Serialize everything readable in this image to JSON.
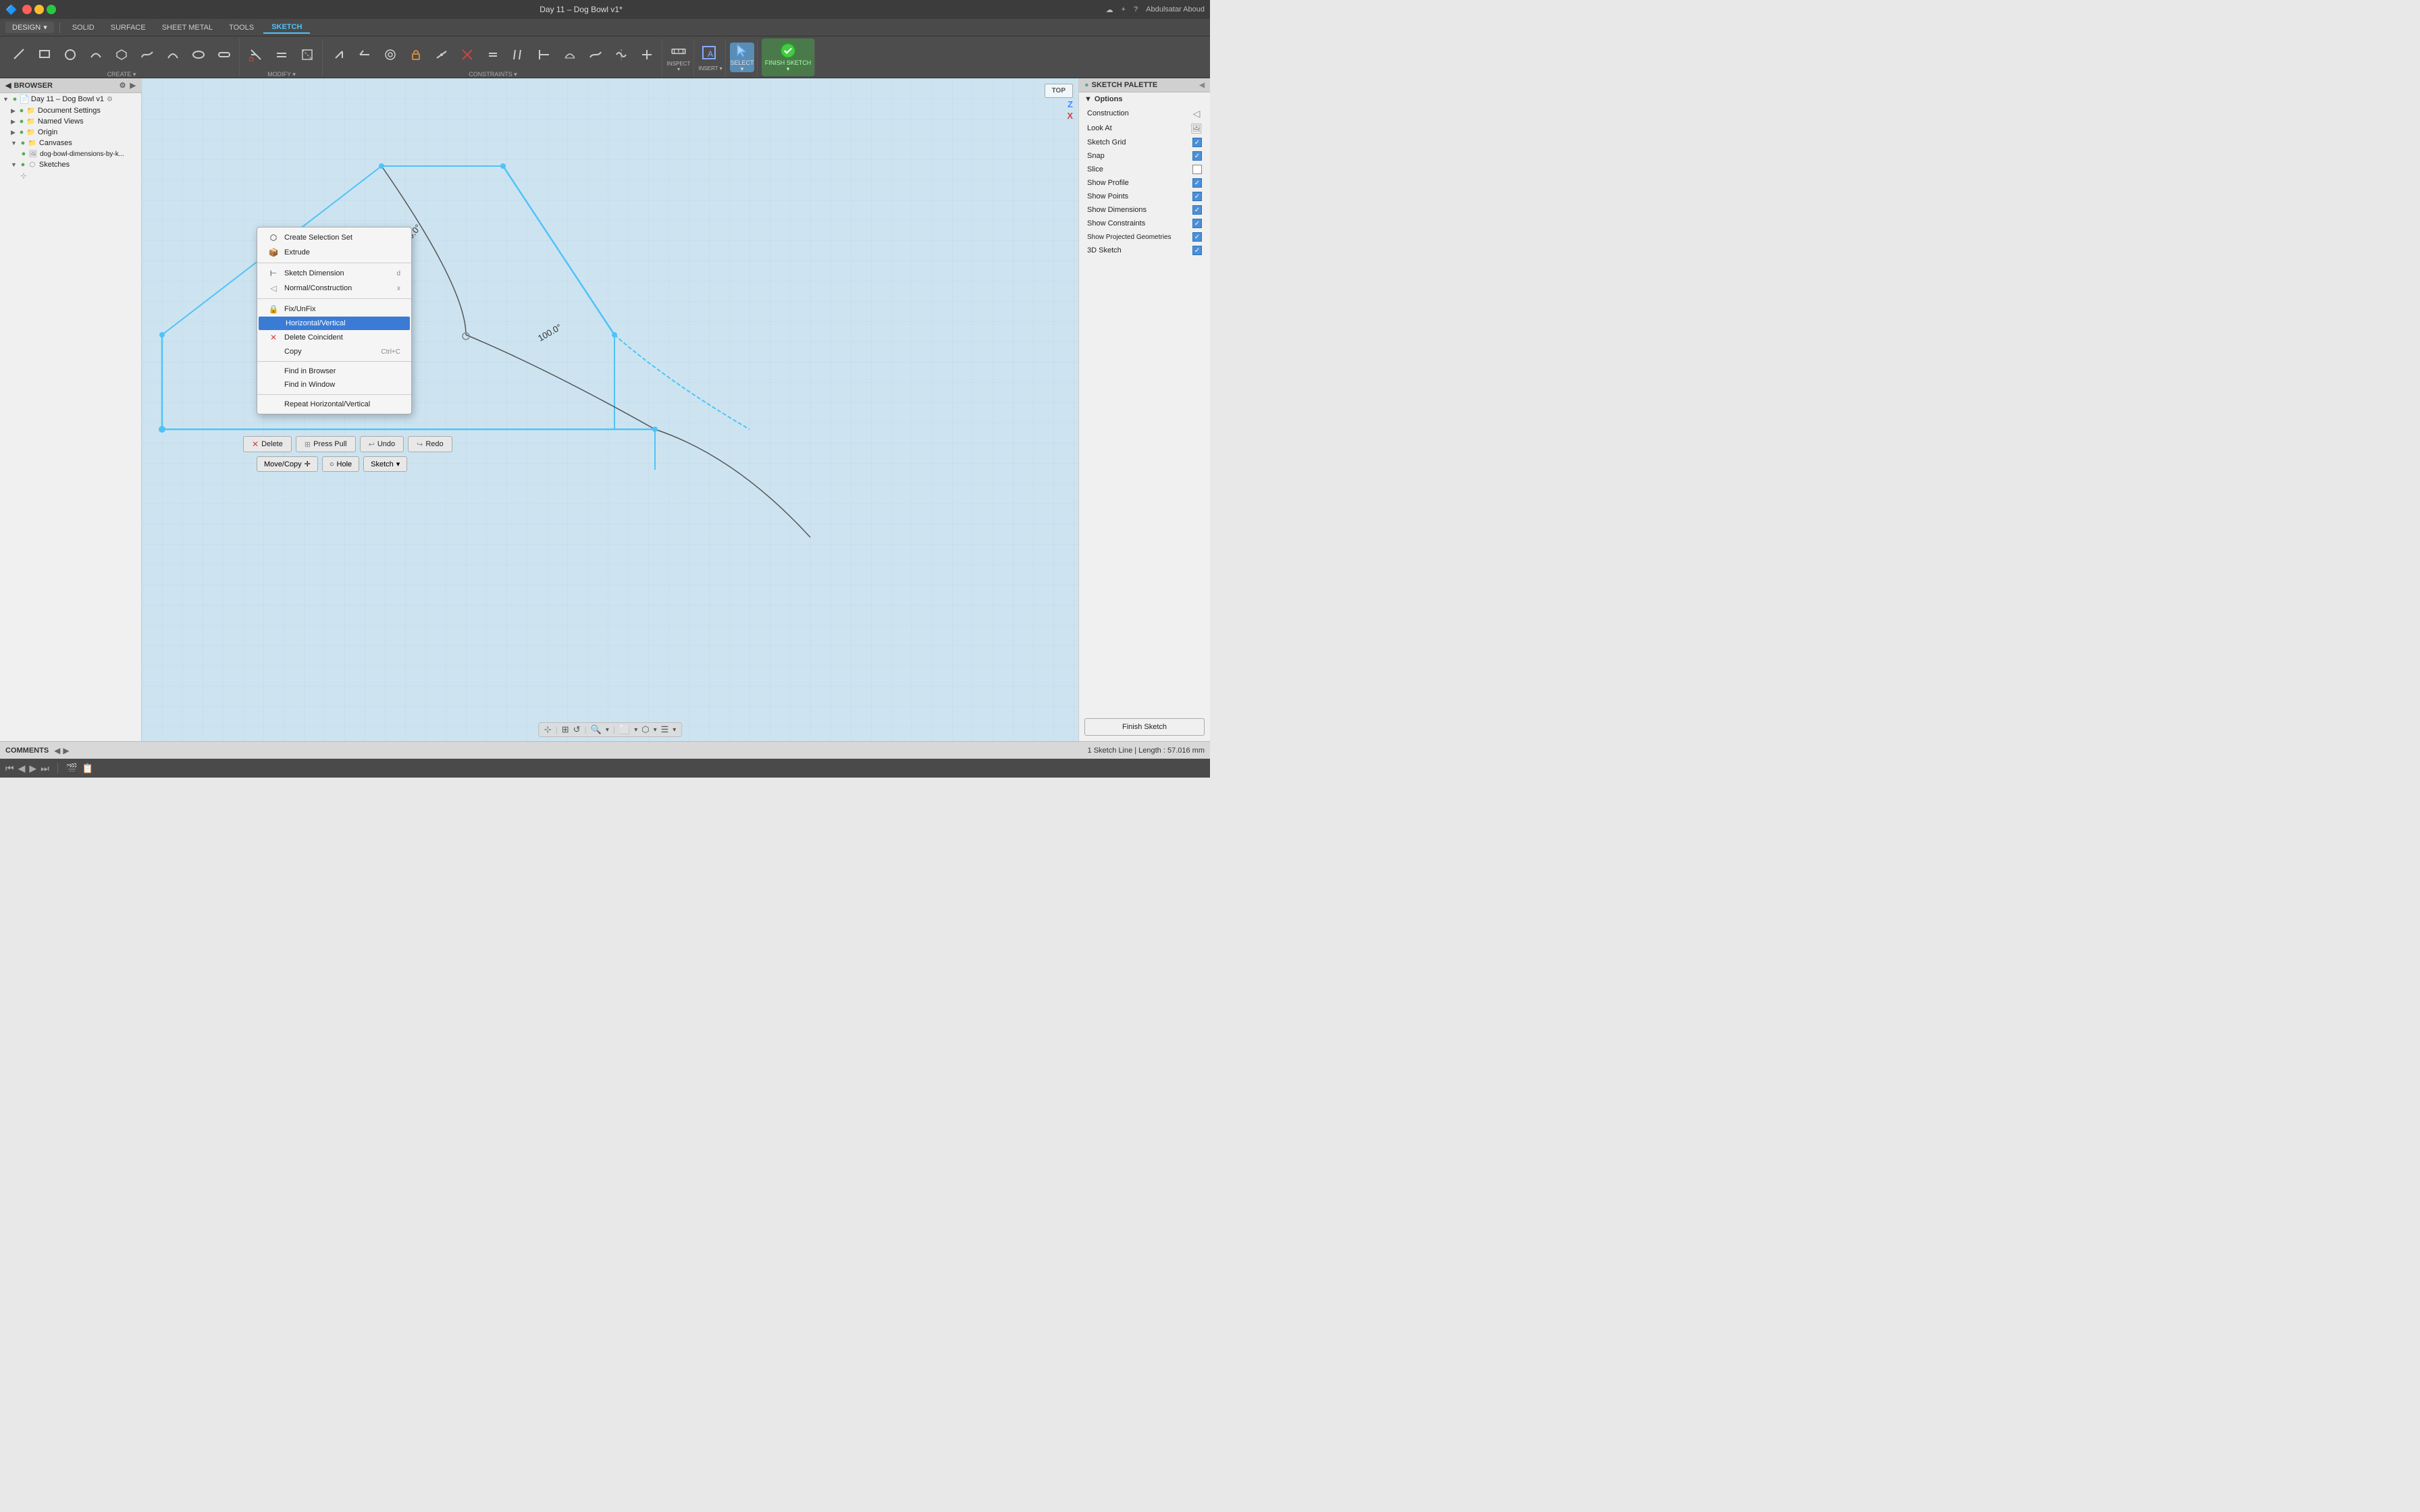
{
  "titlebar": {
    "title": "Day 11 – Dog Bowl v1*",
    "app_icon": "🔷",
    "user": "Abdulsatar Aboud",
    "help_icon": "?",
    "new_tab_icon": "+",
    "cloud_icon": "☁"
  },
  "menubar": {
    "design_label": "DESIGN",
    "tabs": [
      {
        "id": "solid",
        "label": "SOLID"
      },
      {
        "id": "surface",
        "label": "SURFACE"
      },
      {
        "id": "sheet_metal",
        "label": "SHEET METAL"
      },
      {
        "id": "tools",
        "label": "TOOLS"
      },
      {
        "id": "sketch",
        "label": "SKETCH",
        "active": true
      }
    ]
  },
  "toolbar": {
    "create_label": "CREATE",
    "modify_label": "MODIFY",
    "constraints_label": "CONSTRAINTS",
    "inspect_label": "INSPECT",
    "insert_label": "INSERT",
    "select_label": "SELECT",
    "finish_sketch_label": "FINISH SKETCH",
    "tools": [
      {
        "id": "line",
        "icon": "╱",
        "label": ""
      },
      {
        "id": "rect",
        "icon": "▭",
        "label": ""
      },
      {
        "id": "circle",
        "icon": "○",
        "label": ""
      },
      {
        "id": "arc",
        "icon": "◠",
        "label": ""
      },
      {
        "id": "polygon",
        "icon": "⬡",
        "label": ""
      },
      {
        "id": "spline",
        "icon": "∿",
        "label": ""
      },
      {
        "id": "ellipse",
        "icon": "⬭",
        "label": ""
      },
      {
        "id": "triangle",
        "icon": "△",
        "label": ""
      },
      {
        "id": "rect2",
        "icon": "⬜",
        "label": ""
      },
      {
        "id": "trim",
        "icon": "✂",
        "label": ""
      },
      {
        "id": "offset",
        "icon": "⊏",
        "label": ""
      },
      {
        "id": "mirror",
        "icon": "⟺",
        "label": ""
      },
      {
        "id": "project",
        "icon": "⬡",
        "label": ""
      },
      {
        "id": "measure",
        "icon": "⊢",
        "label": ""
      },
      {
        "id": "insert_img",
        "icon": "🖼",
        "label": ""
      },
      {
        "id": "select",
        "icon": "▶",
        "label": "SELECT",
        "active": true
      },
      {
        "id": "finish",
        "icon": "✓",
        "label": "FINISH SKETCH",
        "green": true
      }
    ]
  },
  "browser": {
    "header": "BROWSER",
    "items": [
      {
        "id": "root",
        "label": "Day 11 – Dog Bowl v1",
        "indent": 0,
        "expanded": true,
        "icon": "doc"
      },
      {
        "id": "doc_settings",
        "label": "Document Settings",
        "indent": 1,
        "icon": "gear"
      },
      {
        "id": "named_views",
        "label": "Named Views",
        "indent": 1,
        "icon": "folder"
      },
      {
        "id": "origin",
        "label": "Origin",
        "indent": 1,
        "icon": "origin"
      },
      {
        "id": "canvases",
        "label": "Canvases",
        "indent": 1,
        "expanded": true,
        "icon": "folder"
      },
      {
        "id": "canvas_img",
        "label": "dog-bowl-dimensions-by-k...",
        "indent": 2,
        "icon": "image"
      },
      {
        "id": "sketches",
        "label": "Sketches",
        "indent": 1,
        "icon": "sketch"
      },
      {
        "id": "sketch_icon",
        "label": "",
        "indent": 2,
        "icon": "sketch_small"
      }
    ]
  },
  "viewport": {
    "view_label": "TOP",
    "status_text": "1 Sketch Line | Length : 57.016 mm",
    "sketch_color": "#4fc3f7",
    "construction_color": "#888888"
  },
  "context_menu": {
    "items": [
      {
        "id": "create_selection_set",
        "label": "Create Selection Set",
        "icon": "⬡",
        "shortcut": ""
      },
      {
        "id": "extrude",
        "label": "Extrude",
        "icon": "📦",
        "shortcut": ""
      },
      {
        "id": "sep1",
        "separator": true
      },
      {
        "id": "sketch_dimension",
        "label": "Sketch Dimension",
        "icon": "⊢",
        "shortcut": "d"
      },
      {
        "id": "normal_construction",
        "label": "Normal/Construction",
        "icon": "◁",
        "shortcut": "x"
      },
      {
        "id": "sep2",
        "separator": true
      },
      {
        "id": "fix_unfix",
        "label": "Fix/UnFix",
        "icon": "🔒",
        "shortcut": ""
      },
      {
        "id": "horizontal_vertical",
        "label": "Horizontal/Vertical",
        "icon": "",
        "shortcut": "",
        "highlighted": true
      },
      {
        "id": "delete_coincident",
        "label": "Delete Coincident",
        "icon": "✕",
        "shortcut": ""
      },
      {
        "id": "copy",
        "label": "Copy",
        "icon": "",
        "shortcut": "Ctrl+C"
      },
      {
        "id": "sep3",
        "separator": true
      },
      {
        "id": "find_browser",
        "label": "Find in Browser",
        "icon": "",
        "shortcut": ""
      },
      {
        "id": "find_window",
        "label": "Find in Window",
        "icon": "",
        "shortcut": ""
      },
      {
        "id": "sep4",
        "separator": true
      },
      {
        "id": "repeat",
        "label": "Repeat Horizontal/Vertical",
        "icon": "",
        "shortcut": ""
      }
    ]
  },
  "context_actions": {
    "delete_label": "Delete",
    "delete_icon": "✕",
    "press_pull_label": "Press Pull",
    "press_pull_icon": "⊞",
    "undo_label": "Undo",
    "undo_icon": "↩",
    "redo_label": "Redo",
    "redo_icon": "↪",
    "move_copy_label": "Move/Copy",
    "move_copy_icon": "✛",
    "hole_label": "Hole",
    "hole_icon": "○",
    "sketch_label": "Sketch",
    "sketch_dropdown": "▾"
  },
  "sketch_palette": {
    "header": "SKETCH PALETTE",
    "expand_icon": "◀",
    "options_label": "Options",
    "rows": [
      {
        "id": "construction",
        "label": "Construction",
        "checked": false,
        "has_icon": true,
        "icon": "◁"
      },
      {
        "id": "look_at",
        "label": "Look At",
        "checked": false,
        "has_icon": true,
        "icon": "🖼"
      },
      {
        "id": "sketch_grid",
        "label": "Sketch Grid",
        "checked": true
      },
      {
        "id": "snap",
        "label": "Snap",
        "checked": true
      },
      {
        "id": "slice",
        "label": "Slice",
        "checked": false
      },
      {
        "id": "show_profile",
        "label": "Show Profile",
        "checked": true
      },
      {
        "id": "show_points",
        "label": "Show Points",
        "checked": true
      },
      {
        "id": "show_dimensions",
        "label": "Show Dimensions",
        "checked": true
      },
      {
        "id": "show_constraints",
        "label": "Show Constraints",
        "checked": true
      },
      {
        "id": "show_projected",
        "label": "Show Projected Geometries",
        "checked": true
      },
      {
        "id": "sketch_3d",
        "label": "3D Sketch",
        "checked": true
      }
    ],
    "finish_sketch_label": "Finish Sketch"
  },
  "statusbar": {
    "sketch_status": "1 Sketch Line | Length : 57.016 mm",
    "comments_label": "COMMENTS"
  },
  "bottomnav": {
    "nav_buttons": [
      "⏮",
      "◀",
      "▶",
      "⏭"
    ]
  }
}
